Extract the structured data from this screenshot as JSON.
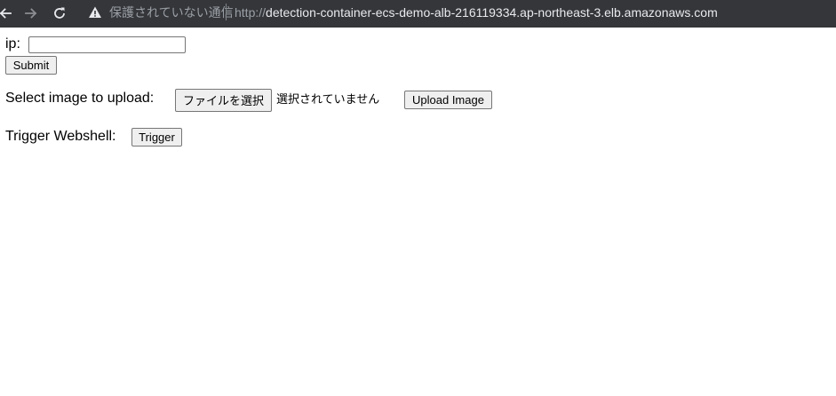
{
  "browser": {
    "security_label": "保護されていない通信",
    "url_scheme": "http://",
    "url_host": "detection-container-ecs-demo-alb-216119334.ap-northeast-3.elb.amazonaws.com"
  },
  "ip_form": {
    "label": "ip:",
    "value": "",
    "submit_label": "Submit"
  },
  "upload_form": {
    "label": "Select image to upload:",
    "choose_file_label": "ファイルを選択",
    "no_file_text": "選択されていません",
    "upload_label": "Upload Image"
  },
  "webshell": {
    "label": "Trigger Webshell:",
    "trigger_label": "Trigger"
  }
}
